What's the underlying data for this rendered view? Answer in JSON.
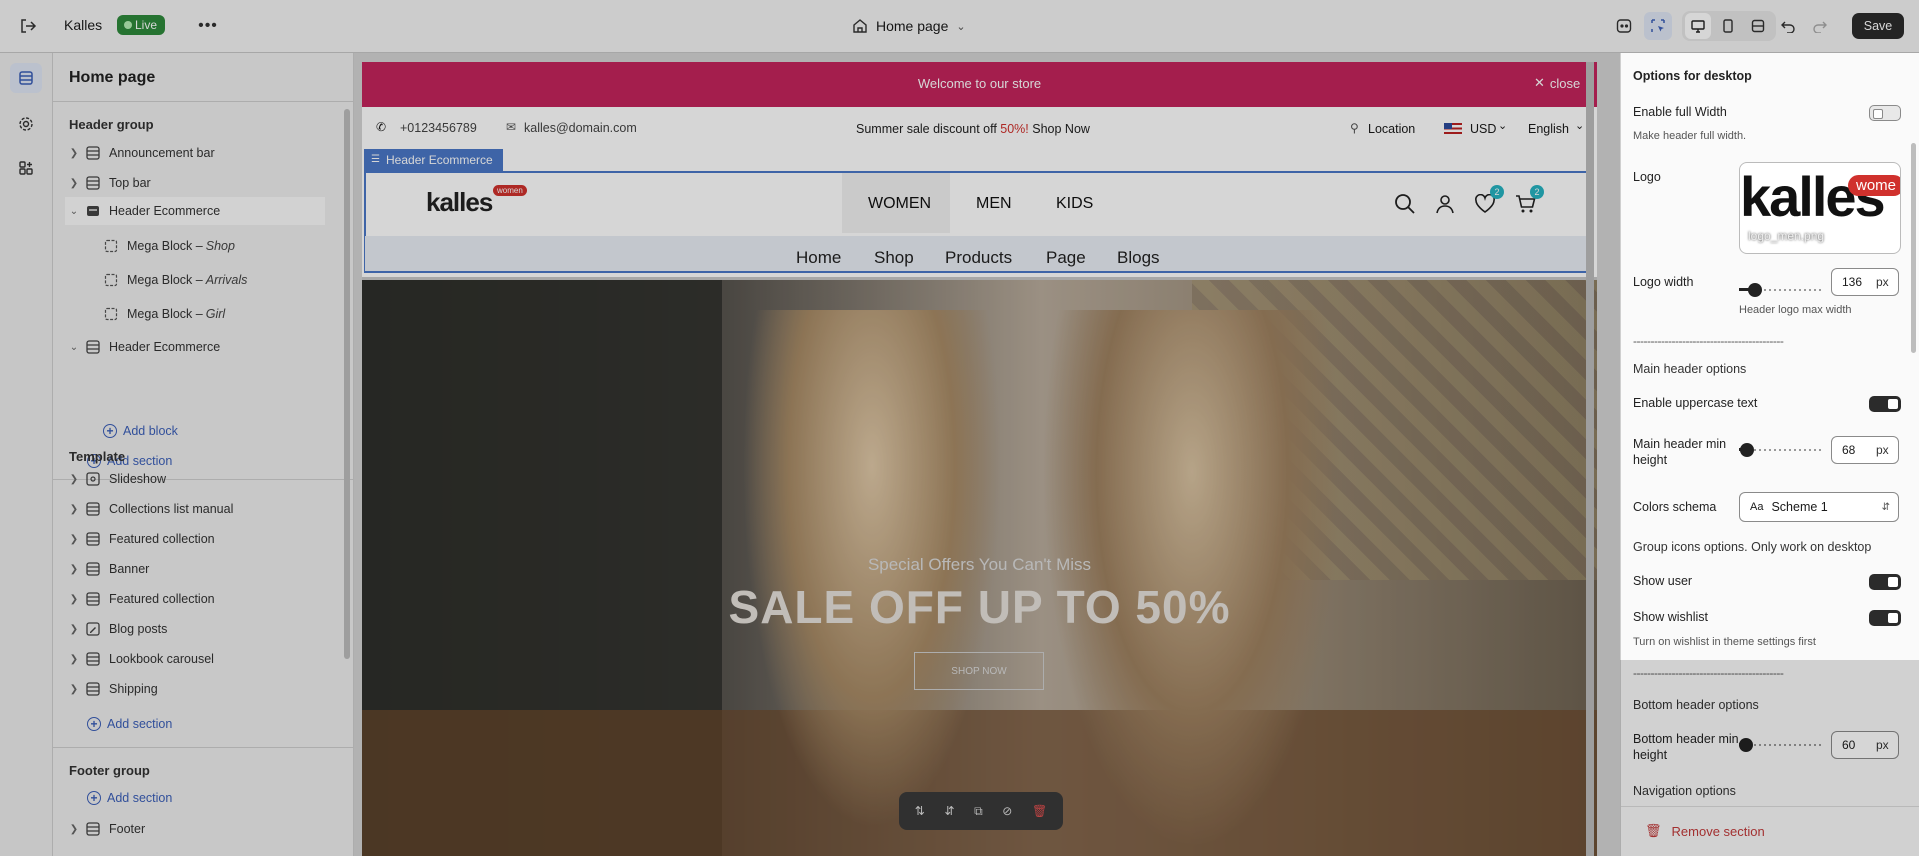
{
  "topbar": {
    "store_name": "Kalles",
    "live_badge": "Live",
    "page_selector": "Home page",
    "save_label": "Save"
  },
  "sidebar": {
    "title": "Home page",
    "header_group": {
      "title": "Header group",
      "items": [
        "Announcement bar",
        "Top bar",
        "Header Ecommerce"
      ],
      "children": [
        {
          "prefix": "Mega Block – ",
          "name": "Shop"
        },
        {
          "prefix": "Mega Block – ",
          "name": "Arrivals"
        },
        {
          "prefix": "Mega Block – ",
          "name": "Girl"
        }
      ],
      "item_after": "Header Ecommerce",
      "add_block": "Add block",
      "add_section": "Add section"
    },
    "template": {
      "title": "Template",
      "items": [
        "Slideshow",
        "Collections list manual",
        "Featured collection",
        "Banner",
        "Featured collection",
        "Blog posts",
        "Lookbook carousel",
        "Shipping"
      ],
      "add_section": "Add section"
    },
    "footer_group": {
      "title": "Footer group",
      "add_section": "Add section",
      "items": [
        "Footer"
      ]
    }
  },
  "preview": {
    "announcement": {
      "text": "Welcome to our store",
      "close": "close",
      "bg": "#c4245c"
    },
    "topbar": {
      "phone": "+0123456789",
      "email": "kalles@domain.com",
      "promo_prefix": "Summer sale discount off ",
      "promo_percent": "50%!",
      "promo_link": "Shop Now",
      "location": "Location",
      "currency": "USD",
      "language": "English"
    },
    "section_label": "Header Ecommerce",
    "logo_text": "kalles",
    "logo_badge": "women",
    "gender_nav": [
      "WOMEN",
      "MEN",
      "KIDS"
    ],
    "wishlist_count": "2",
    "cart_count": "2",
    "main_nav": [
      "Home",
      "Shop",
      "Products",
      "Page",
      "Blogs"
    ],
    "hero": {
      "subtitle": "Special Offers You Can't Miss",
      "title": "SALE OFF UP TO 50%",
      "button": "SHOP NOW"
    }
  },
  "panel": {
    "title": "Options for desktop",
    "enable_full_width": {
      "label": "Enable full Width",
      "hint": "Make header full width.",
      "value": false
    },
    "logo": {
      "label": "Logo",
      "preview_text": "kalles",
      "preview_badge": "wome",
      "file": "logo_men.png"
    },
    "logo_width": {
      "label": "Logo width",
      "value": "136",
      "unit": "px",
      "hint": "Header logo max width",
      "level": 0.19
    },
    "dashes": "-------------------------------------------",
    "main_header_options": "Main header options",
    "uppercase": {
      "label": "Enable uppercase text",
      "value": true
    },
    "main_min_height": {
      "label": "Main header min height",
      "value": "68",
      "unit": "px",
      "level": 0.1
    },
    "colors_schema": {
      "label": "Colors schema",
      "value": "Scheme 1"
    },
    "group_icons": "Group icons options. Only work on desktop",
    "show_user": {
      "label": "Show user",
      "value": true
    },
    "show_wishlist": {
      "label": "Show wishlist",
      "value": true,
      "hint": "Turn on wishlist in theme settings first"
    },
    "bottom_header_options": "Bottom header options",
    "bottom_min_height": {
      "label": "Bottom header min height",
      "value": "60",
      "unit": "px",
      "level": 0.05
    },
    "navigation_options": "Navigation options",
    "remove_section": "Remove section"
  },
  "colors": {
    "accent_pink": "#c4245c",
    "accent_blue": "#4a78c8",
    "red": "#d0312d",
    "badge_teal": "#27b3c2"
  }
}
